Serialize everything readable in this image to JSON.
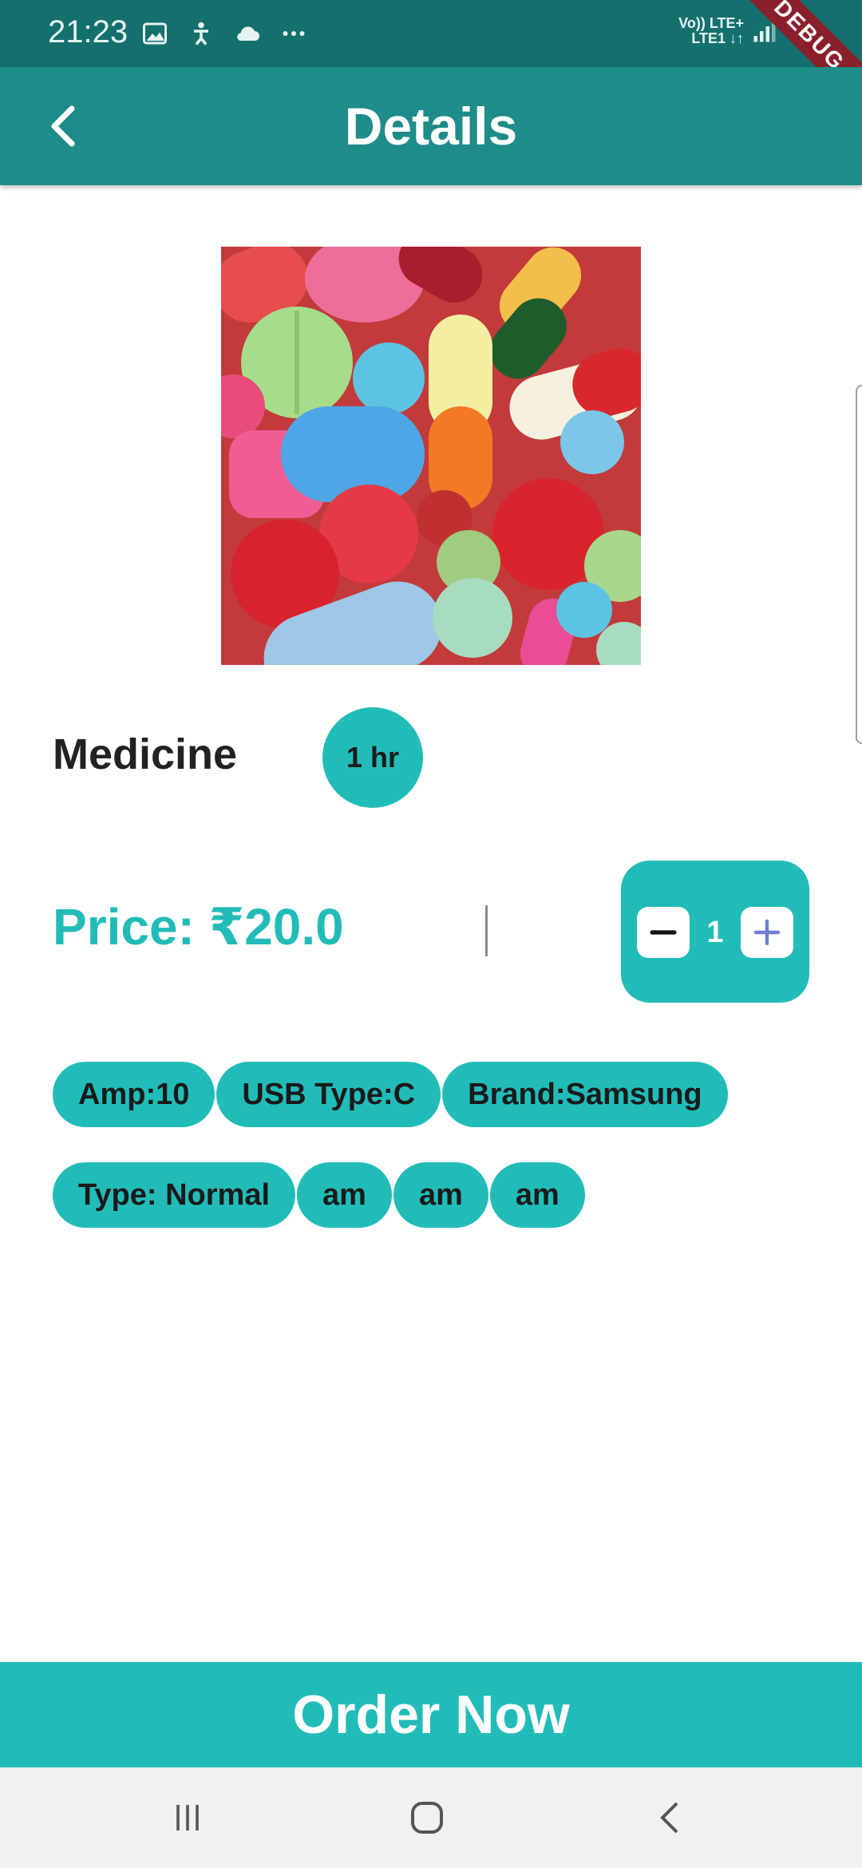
{
  "status_bar": {
    "time": "21:23",
    "icons_left": [
      "image-icon",
      "accessibility-icon",
      "cloud-icon",
      "more-dots-icon"
    ],
    "network_line1": "Vo)) LTE+",
    "network_line2": "LTE1 ↓↑",
    "debug_label": "DEBUG"
  },
  "app_bar": {
    "title": "Details",
    "back_icon": "chevron-left-icon"
  },
  "product": {
    "name": "Medicine",
    "delivery_badge": "1 hr",
    "price": "Price: ₹20.0",
    "quantity": "1"
  },
  "tags": {
    "row1": [
      "Amp:10",
      "USB Type:C",
      "Brand:Samsung"
    ],
    "row2": [
      "Type: Normal",
      "am",
      "am",
      "am"
    ]
  },
  "order_button": "Order Now",
  "colors": {
    "status_bar": "#14706d",
    "app_bar": "#1e8c88",
    "accent": "#22bcb8",
    "debug_banner": "#8b1f2c"
  }
}
